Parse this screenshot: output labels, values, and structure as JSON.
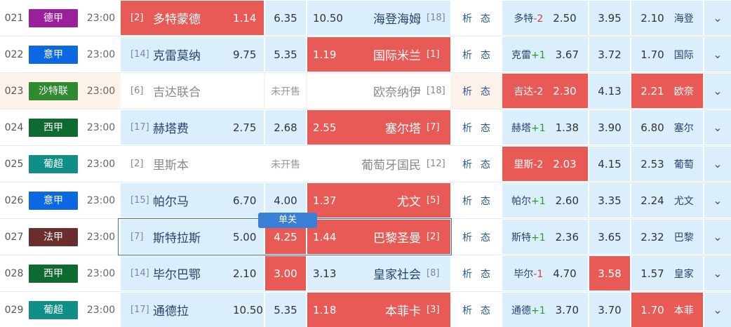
{
  "rows": [
    {
      "num": "021",
      "league": "德甲",
      "lc": "#9b1f9b",
      "time": "23:00",
      "hr": "[2]",
      "home": "多特蒙德",
      "ho": "1.14",
      "d": "6.35",
      "ao": "10.50",
      "away": "海登海姆",
      "ar": "[18]",
      "hl": "多特",
      "hc": "-2",
      "hco": "2.50",
      "hd": "3.95",
      "hao": "2.10",
      "ha": "海登"
    },
    {
      "num": "022",
      "league": "意甲",
      "lc": "#0b67e3",
      "time": "23:00",
      "hr": "[14]",
      "home": "克雷莫纳",
      "ho": "9.75",
      "d": "5.35",
      "ao": "1.19",
      "away": "国际米兰",
      "ar": "[1]",
      "hl": "克雷",
      "hc": "+1",
      "hco": "3.67",
      "hd": "3.72",
      "hao": "1.70",
      "ha": "国际"
    },
    {
      "num": "023",
      "league": "沙特联",
      "lc": "#2e8a2e",
      "time": "23:00",
      "hr": "[6]",
      "home": "吉达联合",
      "ho": "",
      "d": "未开售",
      "ao": "",
      "away": "欧奈纳伊",
      "ar": "[18]",
      "hl": "吉达",
      "hc": "-2",
      "hco": "2.30",
      "hd": "4.13",
      "hao": "2.21",
      "ha": "欧奈"
    },
    {
      "num": "024",
      "league": "西甲",
      "lc": "#0d6b2f",
      "time": "23:00",
      "hr": "[17]",
      "home": "赫塔费",
      "ho": "2.75",
      "d": "2.68",
      "ao": "2.55",
      "away": "塞尔塔",
      "ar": "[7]",
      "hl": "赫塔",
      "hc": "+1",
      "hco": "1.38",
      "hd": "3.90",
      "hao": "6.80",
      "ha": "塞尔"
    },
    {
      "num": "025",
      "league": "葡超",
      "lc": "#0f8f88",
      "time": "23:00",
      "hr": "[2]",
      "home": "里斯本",
      "ho": "",
      "d": "未开售",
      "ao": "",
      "away": "葡萄牙国民",
      "ar": "[12]",
      "hl": "里斯",
      "hc": "-2",
      "hco": "2.03",
      "hd": "4.15",
      "hao": "2.53",
      "ha": "葡萄"
    },
    {
      "num": "026",
      "league": "意甲",
      "lc": "#0b67e3",
      "time": "23:00",
      "hr": "[15]",
      "home": "帕尔马",
      "ho": "6.70",
      "d": "4.00",
      "ao": "1.37",
      "away": "尤文",
      "ar": "[5]",
      "hl": "帕尔",
      "hc": "+1",
      "hco": "2.60",
      "hd": "3.35",
      "hao": "2.24",
      "ha": "尤文"
    },
    {
      "num": "027",
      "league": "法甲",
      "lc": "#6b2e2e",
      "time": "23:00",
      "hr": "[7]",
      "home": "斯特拉斯",
      "ho": "5.00",
      "d": "4.25",
      "ao": "1.44",
      "away": "巴黎圣曼",
      "ar": "[2]",
      "hl": "斯特",
      "hc": "+1",
      "hco": "2.36",
      "hd": "3.65",
      "hao": "2.32",
      "ha": "巴黎"
    },
    {
      "num": "028",
      "league": "西甲",
      "lc": "#0d6b2f",
      "time": "23:00",
      "hr": "[14]",
      "home": "毕尔巴鄂",
      "ho": "2.10",
      "d": "3.00",
      "ao": "3.13",
      "away": "皇家社会",
      "ar": "[8]",
      "hl": "毕尔",
      "hc": "-1",
      "hco": "4.70",
      "hd": "3.58",
      "hao": "1.57",
      "ha": "皇家"
    },
    {
      "num": "029",
      "league": "葡超",
      "lc": "#0f8f88",
      "time": "23:00",
      "hr": "[17]",
      "home": "通德拉",
      "ho": "10.50",
      "d": "5.35",
      "ao": "1.18",
      "away": "本菲卡",
      "ar": "[3]",
      "hl": "通德",
      "hc": "+1",
      "hco": "3.70",
      "hd": "3.70",
      "hao": "1.70",
      "ha": "本菲"
    }
  ],
  "labels": {
    "analysis": "析",
    "state": "态",
    "single": "单关",
    "chevron": "⌄"
  }
}
